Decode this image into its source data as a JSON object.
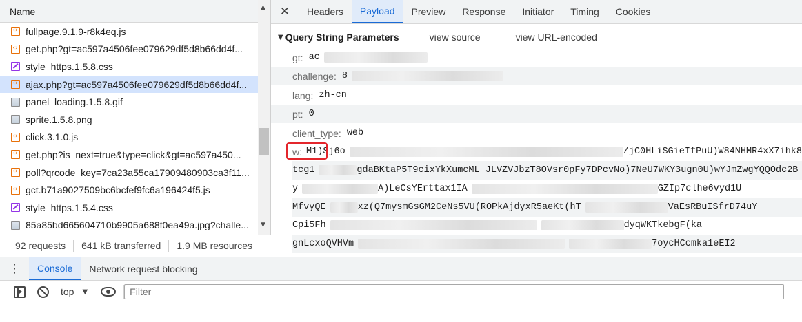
{
  "request_list": {
    "column_header": "Name",
    "items": [
      {
        "name": "fullpage.9.1.9-r8k4eq.js",
        "type": "script"
      },
      {
        "name": "get.php?gt=ac597a4506fee079629df5d8b66dd4f...",
        "type": "script"
      },
      {
        "name": "style_https.1.5.8.css",
        "type": "style"
      },
      {
        "name": "ajax.php?gt=ac597a4506fee079629df5d8b66dd4f...",
        "type": "script",
        "selected": true
      },
      {
        "name": "panel_loading.1.5.8.gif",
        "type": "image"
      },
      {
        "name": "sprite.1.5.8.png",
        "type": "image"
      },
      {
        "name": "click.3.1.0.js",
        "type": "script"
      },
      {
        "name": "get.php?is_next=true&type=click&gt=ac597a450...",
        "type": "script"
      },
      {
        "name": "poll?qrcode_key=7ca23a55ca17909480903ca3f11...",
        "type": "script"
      },
      {
        "name": "gct.b71a9027509bc6bcfef9fc6a196424f5.js",
        "type": "script"
      },
      {
        "name": "style_https.1.5.4.css",
        "type": "style"
      },
      {
        "name": "85a85bd665604710b9905a688f0ea49a.jpg?challe...",
        "type": "image"
      }
    ]
  },
  "status_bar": {
    "requests": "92 requests",
    "transferred": "641 kB transferred",
    "resources": "1.9 MB resources"
  },
  "detail_tabs": {
    "close_glyph": "✕",
    "tabs": [
      "Headers",
      "Payload",
      "Preview",
      "Response",
      "Initiator",
      "Timing",
      "Cookies"
    ],
    "active": "Payload"
  },
  "payload": {
    "section_title": "Query String Parameters",
    "view_source": "view source",
    "view_url_encoded": "view URL-encoded",
    "params": [
      {
        "key": "gt:",
        "value": "ac"
      },
      {
        "key": "challenge:",
        "value": "8"
      },
      {
        "key": "lang:",
        "value": "zh-cn"
      },
      {
        "key": "pt:",
        "value": "0"
      },
      {
        "key": "client_type:",
        "value": "web"
      }
    ],
    "w_key": "w:",
    "w_lines": [
      "M1)Sj6o",
      "tcg1",
      "y",
      "MfvyQE",
      "Cpi5Fh",
      "gnLcxoQVHVm"
    ],
    "w_tails": [
      "/jC0HLiSGieIfPuU)W84NHMR4xX7ihk8",
      "gdaBKtaP",
      "A)Le",
      "xz(Q7mysmGsGM2CeNs5VU(ROPkAjdyxR5aeKt(hT",
      "",
      ""
    ],
    "w_mid": [
      "",
      "5T9cixYkXumcML JLVZVJbzT8OVsr0pFy7DPcvNo)7NeU7WKY3ugn0U)wYJmZwgYQQOdc2B",
      "CsYErttax1IA",
      "",
      "",
      ""
    ],
    "w_right": [
      "",
      "",
      "GZIp7clhe6vyd1U",
      "VaEsRBuISfrD74uY",
      "dyqWKTkebgF(ka",
      "7oycHCcmka1eEI2"
    ]
  },
  "drawer": {
    "menu_glyph": "⋮",
    "tabs": [
      "Console",
      "Network request blocking"
    ],
    "active": "Console"
  },
  "console_toolbar": {
    "context": "top",
    "caret": "▼",
    "filter_placeholder": "Filter"
  }
}
